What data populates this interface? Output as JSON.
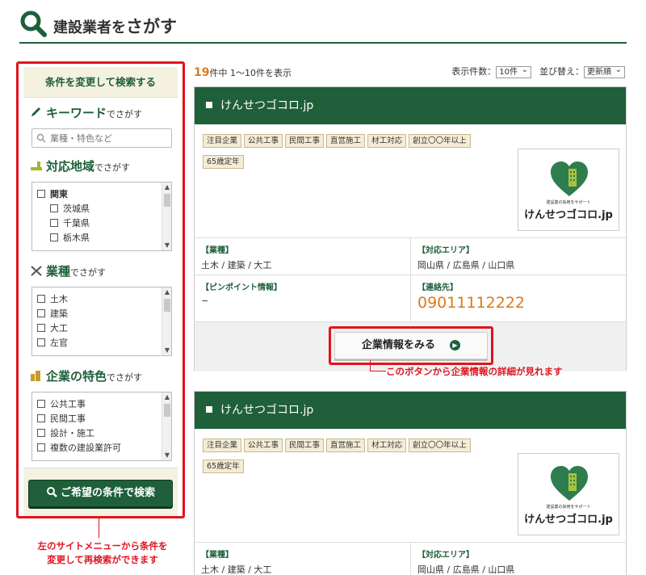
{
  "header": {
    "title_prefix": "建設業者を",
    "title_main": "さがす"
  },
  "sidebar": {
    "heading": "条件を変更して検索する",
    "keyword": {
      "title": "キーワード",
      "suffix": "でさがす",
      "placeholder": "業種・特色など"
    },
    "area": {
      "title": "対応地域",
      "suffix": "でさがす",
      "items": [
        "関東",
        "茨城県",
        "千葉県",
        "栃木県"
      ]
    },
    "industry": {
      "title": "業種",
      "suffix": "でさがす",
      "items": [
        "土木",
        "建築",
        "大工",
        "左官"
      ]
    },
    "features": {
      "title": "企業の特色",
      "suffix": "でさがす",
      "items": [
        "公共工事",
        "民間工事",
        "設計・施工",
        "複数の建設業許可"
      ]
    },
    "submit_label": "ご希望の条件で検索"
  },
  "annotations": {
    "left": "左のサイトメニューから条件を変更して再検索ができます",
    "left_line1": "左のサイトメニューから条件を",
    "left_line2": "変更して再検索ができます",
    "right": "このボタンから企業情報の詳細が見れます"
  },
  "results": {
    "total": "19",
    "summary": "件中 1〜10件を表示",
    "per_page_label": "表示件数：",
    "per_page_value": "10件",
    "sort_label": "並び替え：",
    "sort_value": "更新順"
  },
  "cards": [
    {
      "name": "けんせつゴコロ.jp",
      "tags": [
        "注目企業",
        "公共工事",
        "民間工事",
        "直営施工",
        "材工対応",
        "創立〇〇年以上",
        "65歳定年"
      ],
      "logo_tagline": "建設業の採用をサポート",
      "logo_brand": "けんせつゴコロ.jp",
      "industry_label": "【業種】",
      "industry_value": "土木 / 建築 / 大工",
      "area_label": "【対応エリア】",
      "area_value": "岡山県 / 広島県 / 山口県",
      "pinpoint_label": "【ピンポイント情報】",
      "pinpoint_value": "−",
      "contact_label": "【連絡先】",
      "contact_value": "09011112222",
      "detail_label": "企業情報をみる"
    },
    {
      "name": "けんせつゴコロ.jp",
      "tags": [
        "注目企業",
        "公共工事",
        "民間工事",
        "直営施工",
        "材工対応",
        "創立〇〇年以上",
        "65歳定年"
      ],
      "logo_tagline": "建設業の採用をサポート",
      "logo_brand": "けんせつゴコロ.jp",
      "industry_label": "【業種】",
      "industry_value": "土木 / 建築 / 大工",
      "area_label": "【対応エリア】",
      "area_value": "岡山県 / 広島県 / 山口県"
    }
  ],
  "colors": {
    "brand_green": "#1f5f3a",
    "highlight_red": "#e0141e",
    "accent_orange": "#d97a1a",
    "panel_beige": "#f4f1e1"
  }
}
